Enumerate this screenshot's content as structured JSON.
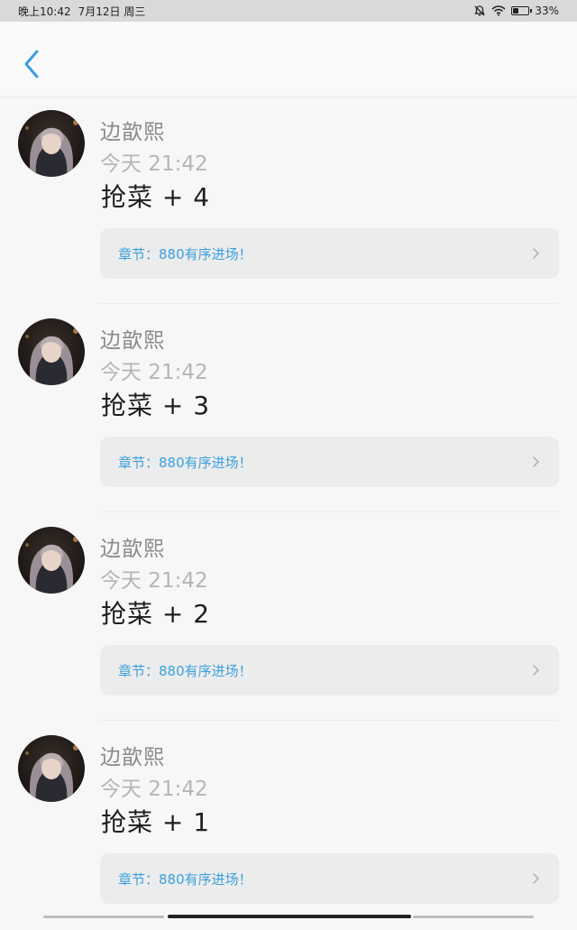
{
  "status_bar": {
    "time": "晚上10:42",
    "date": "7月12日 周三",
    "battery": "33%",
    "battery_level": 0.33,
    "icons": [
      "mute-bell-icon",
      "wifi-icon",
      "battery-icon"
    ]
  },
  "header": {
    "back_icon": "chevron-left-icon",
    "accent_color": "#3a9fe0"
  },
  "items": [
    {
      "author": "边歆熙",
      "time": "今天 21:42",
      "content": "抢菜 + 4",
      "link": "章节：880有序进场！"
    },
    {
      "author": "边歆熙",
      "time": "今天 21:42",
      "content": "抢菜 + 3",
      "link": "章节：880有序进场！"
    },
    {
      "author": "边歆熙",
      "time": "今天 21:42",
      "content": "抢菜 + 2",
      "link": "章节：880有序进场！"
    },
    {
      "author": "边歆熙",
      "time": "今天 21:42",
      "content": "抢菜 + 1",
      "link": "章节：880有序进场！"
    }
  ],
  "colors": {
    "link_text": "#3aa0dd",
    "background": "#f7f7f7",
    "card": "#ececec"
  }
}
